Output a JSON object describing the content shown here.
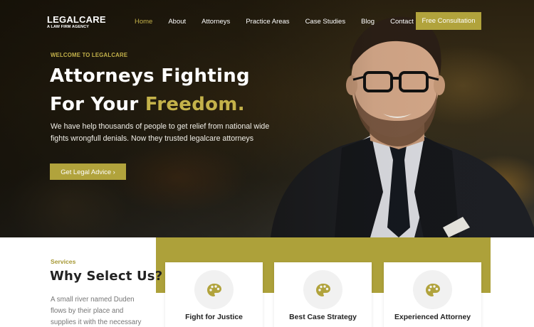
{
  "brand": {
    "name": "LEGALCARE",
    "tagline": "A LAW FIRM AGENCY"
  },
  "nav": {
    "items": [
      {
        "label": "Home",
        "active": true
      },
      {
        "label": "About"
      },
      {
        "label": "Attorneys"
      },
      {
        "label": "Practice Areas"
      },
      {
        "label": "Case Studies"
      },
      {
        "label": "Blog"
      },
      {
        "label": "Contact"
      }
    ],
    "cta_label": "Free Consultation"
  },
  "hero": {
    "eyebrow": "WELCOME TO LEGALCARE",
    "headline_line1": "Attorneys Fighting",
    "headline_line2_prefix": "For Your ",
    "headline_line2_accent": "Freedom.",
    "paragraph": "We have help thousands of people to get relief from national wide fights wrongfull denials. Now they trusted legalcare attorneys",
    "button_label": "Get Legal Advice ›"
  },
  "services": {
    "label": "Services",
    "title": "Why Select Us?",
    "paragraph": "A small river named Duden flows by their place and supplies it with the necessary",
    "cards": [
      {
        "title": "Fight for Justice",
        "icon": "palette-icon"
      },
      {
        "title": "Best Case Strategy",
        "icon": "palette-icon"
      },
      {
        "title": "Experienced Attorney",
        "icon": "palette-icon"
      }
    ]
  },
  "colors": {
    "accent": "#b1a33c",
    "accent_text": "#c4b24a",
    "heading": "#222222",
    "body_text": "#777777"
  }
}
